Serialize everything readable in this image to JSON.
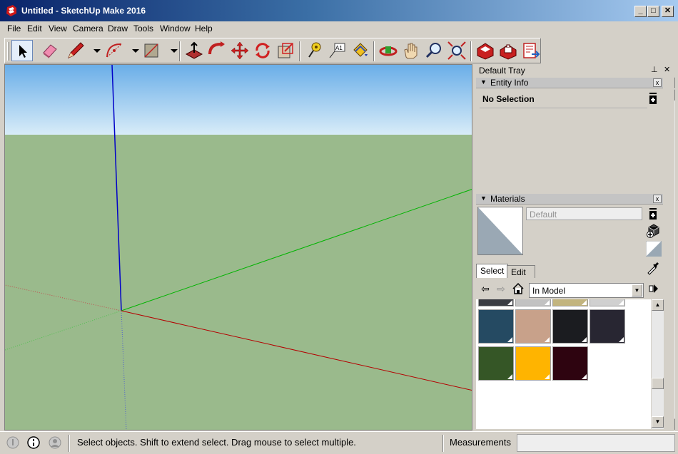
{
  "window": {
    "title": "Untitled - SketchUp Make 2016",
    "minimize": "_",
    "maximize": "□",
    "close": "✕"
  },
  "menu": [
    "File",
    "Edit",
    "View",
    "Camera",
    "Draw",
    "Tools",
    "Window",
    "Help"
  ],
  "toolbar": {
    "tools": [
      "select",
      "eraser",
      "pencil-line",
      "arc",
      "rectangle",
      "push-pull",
      "follow-me",
      "move",
      "rotate",
      "scale",
      "tape-measure",
      "text",
      "paint-bucket",
      "orbit",
      "pan",
      "zoom",
      "zoom-extents",
      "3d-warehouse",
      "extension-warehouse",
      "layout"
    ],
    "text_tool_label": "A1"
  },
  "tray": {
    "title": "Default Tray",
    "pin": "⊥",
    "close": "✕",
    "entity_info": {
      "header": "Entity Info",
      "selection": "No Selection"
    },
    "materials": {
      "header": "Materials",
      "name_value": "Default",
      "tabs": [
        "Select",
        "Edit"
      ],
      "active_tab": "Select",
      "collection": "In Model",
      "swatches": [
        {
          "color": "#3a3c42",
          "partial": true
        },
        {
          "color": "#c2c2c2",
          "partial": true
        },
        {
          "color": "#c2b47e",
          "partial": true
        },
        {
          "color": "#d0d0d0",
          "partial": true
        },
        {
          "color": "#254a62"
        },
        {
          "color": "#c8a18a"
        },
        {
          "color": "#1b1c20"
        },
        {
          "color": "#282632"
        },
        {
          "color": "#355626"
        },
        {
          "color": "#ffb400"
        },
        {
          "color": "#2e0410"
        }
      ]
    }
  },
  "status": {
    "message": "Select objects. Shift to extend select. Drag mouse to select multiple.",
    "measurements_label": "Measurements",
    "measurements_value": ""
  },
  "viewport": {
    "sky_top": "#6aaee8",
    "sky_bottom": "#d8ecf8",
    "ground": "#9aba8c",
    "axis_red": "#b40000",
    "axis_green": "#00b400",
    "axis_blue": "#0000c8"
  }
}
